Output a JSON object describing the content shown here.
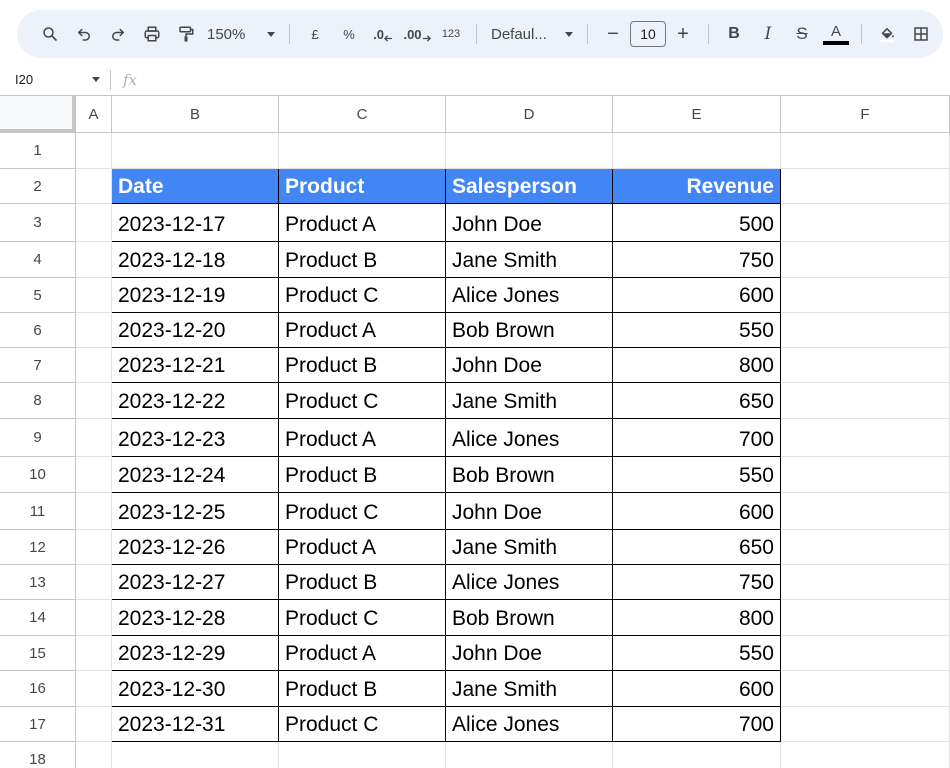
{
  "toolbar": {
    "zoom": "150%",
    "currency_label": "£",
    "percent_label": "%",
    "decrease_decimal_label": ".0",
    "increase_decimal_label": ".00",
    "number_format_label": "123",
    "font_family": "Defaul...",
    "font_size": "10",
    "decrease_label": "−",
    "increase_label": "+",
    "bold_label": "B",
    "italic_label": "I",
    "strike_label": "S",
    "text_color_label": "A",
    "text_color": "#000000"
  },
  "formula_bar": {
    "cell_ref": "I20",
    "fx_label": "fx",
    "content": ""
  },
  "columns": [
    "A",
    "B",
    "C",
    "D",
    "E",
    "F"
  ],
  "rows": [
    "1",
    "2",
    "3",
    "4",
    "5",
    "6",
    "7",
    "8",
    "9",
    "10",
    "11",
    "12",
    "13",
    "14",
    "15",
    "16",
    "17",
    "18"
  ],
  "table": {
    "header_bg": "#4285f4",
    "headers": [
      "Date",
      "Product",
      "Salesperson",
      "Revenue"
    ],
    "data": [
      [
        "2023-12-17",
        "Product A",
        "John Doe",
        "500"
      ],
      [
        "2023-12-18",
        "Product B",
        "Jane Smith",
        "750"
      ],
      [
        "2023-12-19",
        "Product C",
        "Alice Jones",
        "600"
      ],
      [
        "2023-12-20",
        "Product A",
        "Bob Brown",
        "550"
      ],
      [
        "2023-12-21",
        "Product B",
        "John Doe",
        "800"
      ],
      [
        "2023-12-22",
        "Product C",
        "Jane Smith",
        "650"
      ],
      [
        "2023-12-23",
        "Product A",
        "Alice Jones",
        "700"
      ],
      [
        "2023-12-24",
        "Product B",
        "Bob Brown",
        "550"
      ],
      [
        "2023-12-25",
        "Product C",
        "John Doe",
        "600"
      ],
      [
        "2023-12-26",
        "Product A",
        "Jane Smith",
        "650"
      ],
      [
        "2023-12-27",
        "Product B",
        "Alice Jones",
        "750"
      ],
      [
        "2023-12-28",
        "Product C",
        "Bob Brown",
        "800"
      ],
      [
        "2023-12-29",
        "Product A",
        "John Doe",
        "550"
      ],
      [
        "2023-12-30",
        "Product B",
        "Jane Smith",
        "600"
      ],
      [
        "2023-12-31",
        "Product C",
        "Alice Jones",
        "700"
      ]
    ]
  }
}
